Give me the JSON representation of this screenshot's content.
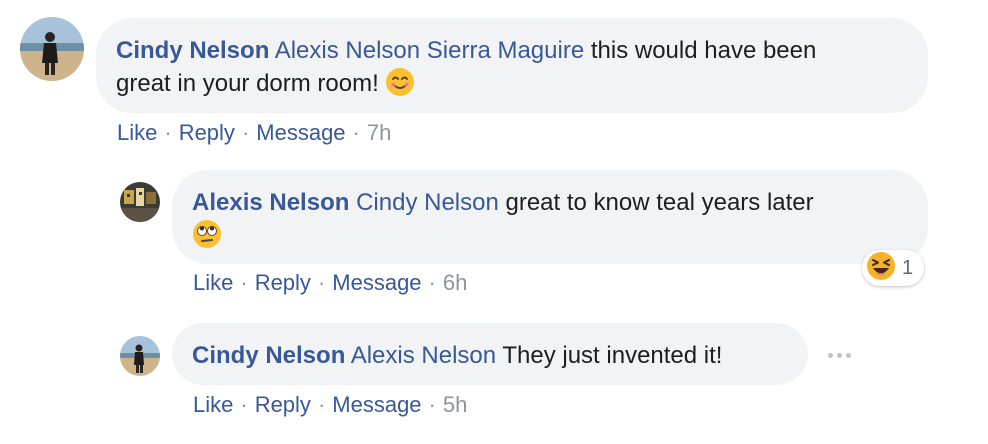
{
  "comments": [
    {
      "author": "Cindy Nelson",
      "mentions": [
        "Alexis Nelson",
        "Sierra Maguire"
      ],
      "text_line1": "this would have been",
      "text_line2": "great in your dorm room!",
      "emoji": "smiling-face-emoji",
      "actions": {
        "like": "Like",
        "reply": "Reply",
        "message": "Message",
        "time": "7h"
      }
    },
    {
      "author": "Alexis Nelson",
      "mentions": [
        "Cindy Nelson"
      ],
      "text_line1": "great to know teal years later",
      "emoji": "eye-roll-emoji",
      "reaction": {
        "icon": "haha-reaction-icon",
        "count": "1"
      },
      "actions": {
        "like": "Like",
        "reply": "Reply",
        "message": "Message",
        "time": "6h"
      }
    },
    {
      "author": "Cindy Nelson",
      "mentions": [
        "Alexis Nelson"
      ],
      "text_line1": "They just invented it!",
      "actions": {
        "like": "Like",
        "reply": "Reply",
        "message": "Message",
        "time": "5h"
      }
    }
  ],
  "colors": {
    "link": "#385898",
    "bubble": "#f2f3f5",
    "meta": "#90949c"
  }
}
